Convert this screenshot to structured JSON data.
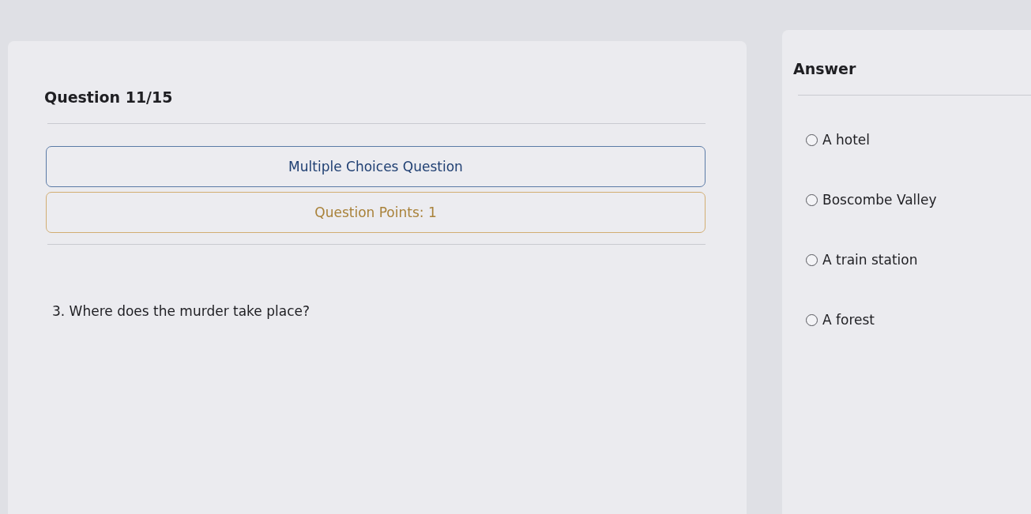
{
  "question_panel": {
    "title": "Question 11/15",
    "type_box": {
      "label": "Multiple Choices Question"
    },
    "points_box": {
      "label": "Question Points: 1"
    },
    "question": "3. Where does the murder take place?"
  },
  "answer_panel": {
    "title": "Answer",
    "options": [
      {
        "label": "A hotel",
        "selected": false
      },
      {
        "label": "Boscombe Valley",
        "selected": false
      },
      {
        "label": "A train station",
        "selected": false
      },
      {
        "label": "A forest",
        "selected": false
      }
    ]
  }
}
